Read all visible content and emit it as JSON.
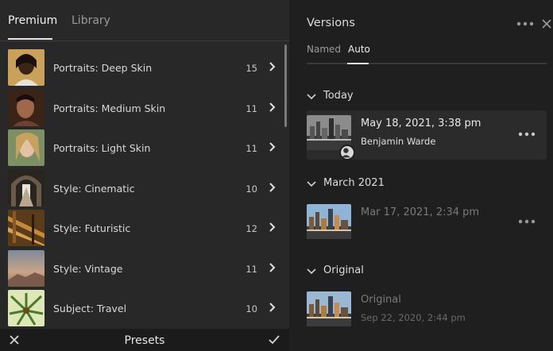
{
  "left_panel": {
    "tabs": [
      {
        "label": "Premium",
        "active": true
      },
      {
        "label": "Library",
        "active": false
      }
    ],
    "presets": [
      {
        "name": "Portraits: Deep Skin",
        "count": "15",
        "thumb_icon": "portrait-deep-skin-thumbnail"
      },
      {
        "name": "Portraits: Medium Skin",
        "count": "11",
        "thumb_icon": "portrait-medium-skin-thumbnail"
      },
      {
        "name": "Portraits: Light Skin",
        "count": "11",
        "thumb_icon": "portrait-light-skin-thumbnail"
      },
      {
        "name": "Style: Cinematic",
        "count": "10",
        "thumb_icon": "cinematic-thumbnail"
      },
      {
        "name": "Style: Futuristic",
        "count": "12",
        "thumb_icon": "futuristic-thumbnail"
      },
      {
        "name": "Style: Vintage",
        "count": "11",
        "thumb_icon": "vintage-thumbnail"
      },
      {
        "name": "Subject: Travel",
        "count": "10",
        "thumb_icon": "travel-thumbnail"
      }
    ],
    "bottom_bar": {
      "title": "Presets",
      "cancel_icon": "close-icon",
      "confirm_icon": "checkmark-icon"
    }
  },
  "right_panel": {
    "title": "Versions",
    "subtabs": [
      {
        "label": "Named",
        "active": false
      },
      {
        "label": "Auto",
        "active": true
      }
    ],
    "sections": [
      {
        "label": "Today",
        "versions": [
          {
            "title": "May 18, 2021, 3:38 pm",
            "subtitle": "Benjamin Warde",
            "selected": true,
            "dim": false
          }
        ]
      },
      {
        "label": "March 2021",
        "versions": [
          {
            "title": "Mar 17, 2021, 2:34 pm",
            "subtitle": "",
            "selected": false,
            "dim": true
          }
        ]
      },
      {
        "label": "Original",
        "versions": [
          {
            "title": "Original",
            "subtitle": "Sep 22, 2020, 2:44 pm",
            "selected": false,
            "dim": true
          }
        ]
      }
    ]
  },
  "colors": {
    "left_bg": "#282828",
    "right_bg": "#1f1f1f",
    "bottom_bar_bg": "#1b1b1b",
    "selected_row_bg": "#2b2b2b"
  }
}
